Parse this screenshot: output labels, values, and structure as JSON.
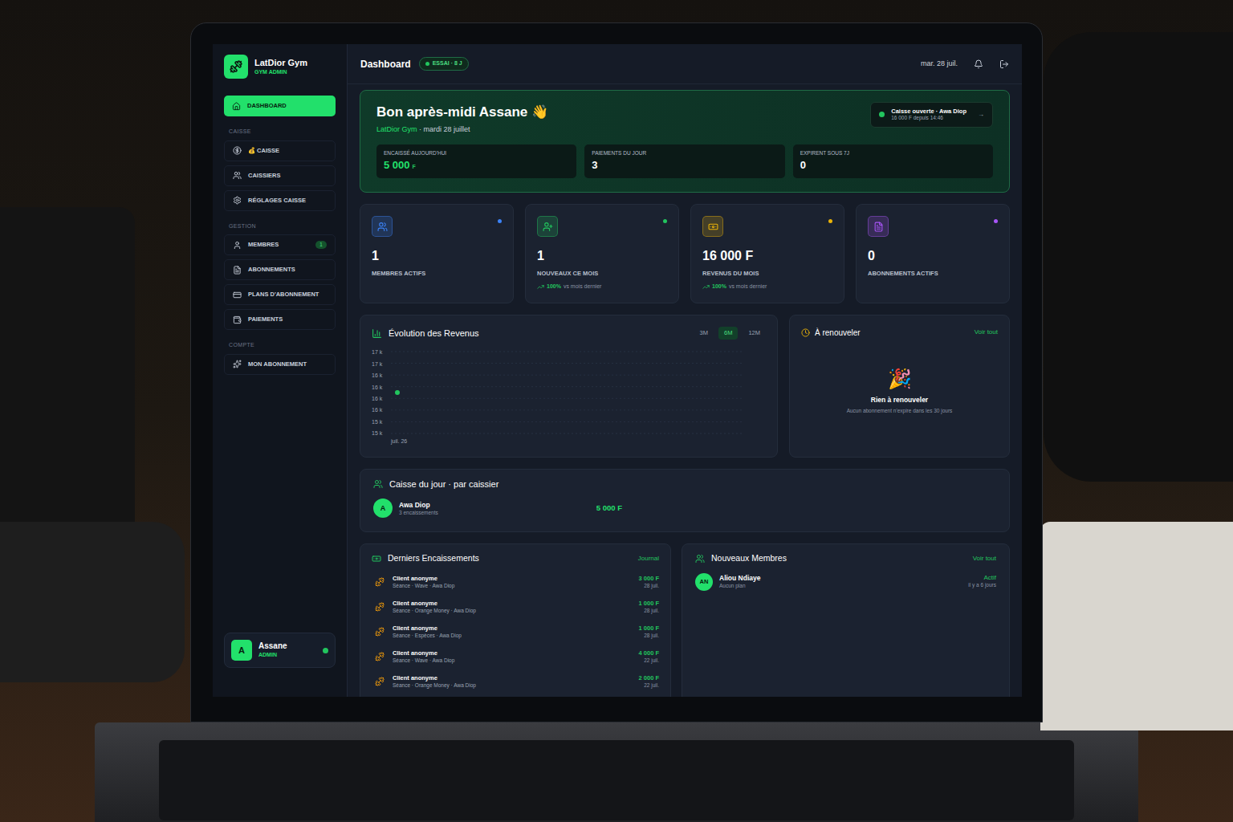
{
  "app": {
    "name": "LatDior Gym",
    "role": "GYM ADMIN"
  },
  "sidebar": {
    "sections": [
      {
        "items": [
          {
            "label": "DASHBOARD",
            "selected": true
          }
        ]
      },
      {
        "title": "CAISSE",
        "items": [
          {
            "label": "💰 CAISSE",
            "selected": false
          },
          {
            "label": "CAISSIERS",
            "selected": false
          },
          {
            "label": "RÉGLAGES CAISSE",
            "selected": false
          }
        ]
      },
      {
        "title": "GESTION",
        "items": [
          {
            "label": "MEMBRES",
            "selected": false,
            "badge": "1"
          },
          {
            "label": "ABONNEMENTS",
            "selected": false
          },
          {
            "label": "PLANS D'ABONNEMENT",
            "selected": false
          },
          {
            "label": "PAIEMENTS",
            "selected": false
          }
        ]
      },
      {
        "title": "COMPTE",
        "items": [
          {
            "label": "MON ABONNEMENT",
            "selected": false
          }
        ]
      }
    ],
    "user": {
      "initial": "A",
      "name": "Assane",
      "role": "ADMIN",
      "online": true
    }
  },
  "header": {
    "title": "Dashboard",
    "badge": "ESSAI · 8 J",
    "date": "mar. 28 juil."
  },
  "hero": {
    "greeting": "Bon après-midi Assane 👋",
    "gym": "LatDior Gym",
    "date_text": "· mardi 28 juillet",
    "register": {
      "title": "Caisse ouverte · Awa Diop",
      "subtitle": "16 000 F depuis 14:46",
      "arrow": "→",
      "open": true
    },
    "stats": [
      {
        "label": "ENCAISSÉ AUJOURD'HUI",
        "value": "5 000",
        "unit": "F",
        "highlight": true
      },
      {
        "label": "PAIEMENTS DU JOUR",
        "value": "3",
        "highlight": false
      },
      {
        "label": "EXPIRENT SOUS 7J",
        "value": "0",
        "highlight": false
      }
    ]
  },
  "kpis": [
    {
      "value": "1",
      "label": "MEMBRES ACTIFS",
      "color": "#3b82f6"
    },
    {
      "value": "1",
      "label": "NOUVEAUX CE MOIS",
      "color": "#22c55e",
      "trend": "100%",
      "trend_text": "vs mois dernier"
    },
    {
      "value": "16 000 F",
      "label": "REVENUS DU MOIS",
      "color": "#eab308",
      "trend": "100%",
      "trend_text": "vs mois dernier"
    },
    {
      "value": "0",
      "label": "ABONNEMENTS ACTIFS",
      "color": "#a855f7"
    }
  ],
  "chart": {
    "title": "Évolution des Revenus",
    "ranges": [
      {
        "label": "3M",
        "selected": false
      },
      {
        "label": "6M",
        "selected": true
      },
      {
        "label": "12M",
        "selected": false
      }
    ],
    "y_ticks": [
      "17 k",
      "17 k",
      "16 k",
      "16 k",
      "16 k",
      "16 k",
      "15 k",
      "15 k"
    ],
    "x_ticks": [
      "juil. 26"
    ],
    "series": [
      {
        "values": [
          16000
        ]
      }
    ]
  },
  "renew": {
    "title": "À renouveler",
    "link": "Voir tout",
    "emoji": "🎉",
    "empty_title": "Rien à renouveler",
    "empty_text": "Aucun abonnement n'expire dans les 30 jours"
  },
  "cashiers": {
    "title": "Caisse du jour · par caissier",
    "rows": [
      {
        "initial": "A",
        "name": "Awa Diop",
        "detail": "3 encaissements",
        "amount": "5 000 F"
      }
    ]
  },
  "payments": {
    "title": "Derniers Encaissements",
    "link": "Journal",
    "rows": [
      {
        "name": "Client anonyme",
        "detail": "Séance · Wave · Awa Diop",
        "amount": "3 000 F",
        "date": "28 juil."
      },
      {
        "name": "Client anonyme",
        "detail": "Séance · Orange Money · Awa Diop",
        "amount": "1 000 F",
        "date": "28 juil."
      },
      {
        "name": "Client anonyme",
        "detail": "Séance · Espèces · Awa Diop",
        "amount": "1 000 F",
        "date": "28 juil."
      },
      {
        "name": "Client anonyme",
        "detail": "Séance · Wave · Awa Diop",
        "amount": "4 000 F",
        "date": "22 juil."
      },
      {
        "name": "Client anonyme",
        "detail": "Séance · Orange Money · Awa Diop",
        "amount": "2 000 F",
        "date": "22 juil."
      }
    ]
  },
  "members": {
    "title": "Nouveaux Membres",
    "link": "Voir tout",
    "rows": [
      {
        "initials": "AN",
        "name": "Aliou Ndiaye",
        "plan": "Aucun plan",
        "status": "Actif",
        "time": "il y a 6 jours"
      }
    ]
  }
}
